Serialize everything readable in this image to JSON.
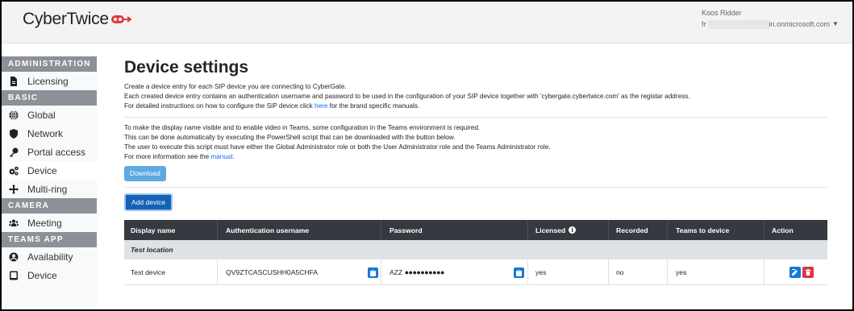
{
  "header": {
    "logo_text": "CyberTwice",
    "user_name": "Koos Ridder",
    "email_prefix": "fr",
    "email_suffix": "in.onmicrosoft.com"
  },
  "sidebar": {
    "sections": [
      {
        "title": "ADMINISTRATION",
        "items": [
          {
            "label": "Licensing",
            "icon": "file-icon"
          }
        ]
      },
      {
        "title": "BASIC",
        "items": [
          {
            "label": "Global",
            "icon": "globe-icon"
          },
          {
            "label": "Network",
            "icon": "shield-icon"
          },
          {
            "label": "Portal access",
            "icon": "key-icon"
          },
          {
            "label": "Device",
            "icon": "cogs-icon",
            "active": true
          },
          {
            "label": "Multi-ring",
            "icon": "arrows-icon"
          }
        ]
      },
      {
        "title": "CAMERA",
        "items": [
          {
            "label": "Meeting",
            "icon": "users-icon"
          }
        ]
      },
      {
        "title": "TEAMS APP",
        "items": [
          {
            "label": "Availability",
            "icon": "user-circle-icon"
          },
          {
            "label": "Device",
            "icon": "tablet-icon"
          }
        ]
      }
    ]
  },
  "main": {
    "title": "Device settings",
    "intro_line1": "Create a device entry for each SIP device you are connecting to CyberGate.",
    "intro_line2": "Each created device entry contains an authentication username and password to be used in the configuration of your SIP device together with 'cybergate.cybertwice.com' as the registar address.",
    "intro_line3_pre": "For detailed instructions on how to configure the SIP device click ",
    "intro_line3_link": "here",
    "intro_line3_post": " for the brand specific manuals.",
    "teams_line1": "To make the display name visible and to enable video in Teams, some configuration in the Teams environment is required.",
    "teams_line2": "This can be done automatically by executing the PowerShell script that can be downloaded with the button below.",
    "teams_line3": "The user to execute this script must have either the Global Administrator role or both the User Administrator role and the Teams Administrator role.",
    "teams_line4_pre": "For more information see the ",
    "teams_line4_link": "manual",
    "teams_line4_post": ".",
    "download_label": "Download",
    "add_device_label": "Add device"
  },
  "table": {
    "headers": [
      "Display name",
      "Authentication username",
      "Password",
      "Licensed",
      "Recorded",
      "Teams to device",
      "Action"
    ],
    "group": "Test location",
    "rows": [
      {
        "display_name": "Test device",
        "auth_username": "QV9ZTCASCUSHH0A5CHFA",
        "password_prefix": "AZZ",
        "password_mask": "●●●●●●●●●●",
        "licensed": "yes",
        "recorded": "no",
        "teams_to_device": "yes"
      }
    ]
  },
  "colors": {
    "accent": "#1262b5",
    "delete": "#dc3545",
    "edit": "#1878d6",
    "table_header": "#343a40"
  }
}
